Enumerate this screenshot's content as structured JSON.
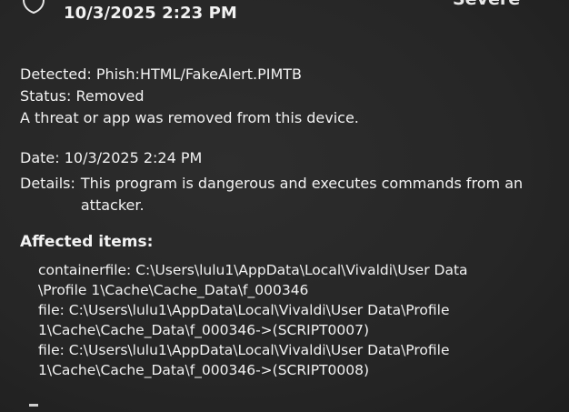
{
  "header": {
    "date_time": "10/3/2025 2:23 PM",
    "severity": "Severe"
  },
  "summary": {
    "detected_label": "Detected:",
    "detected_value": "Phish:HTML/FakeAlert.PIMTB",
    "status_label": "Status:",
    "status_value": "Removed",
    "message": "A threat or app was removed from this device."
  },
  "details": {
    "date_label": "Date:",
    "date_value": "10/3/2025 2:24 PM",
    "details_label": "Details:",
    "details_line1": "This program is dangerous and executes commands from an",
    "details_line2": "attacker."
  },
  "affected": {
    "title": "Affected items:",
    "items": [
      {
        "line1": "containerfile: C:\\Users\\lulu1\\AppData\\Local\\Vivaldi\\User Data",
        "line2": "\\Profile 1\\Cache\\Cache_Data\\f_000346"
      },
      {
        "line1": "file: C:\\Users\\lulu1\\AppData\\Local\\Vivaldi\\User Data\\Profile",
        "line2": "1\\Cache\\Cache_Data\\f_000346->(SCRIPT0007)"
      },
      {
        "line1": "file: C:\\Users\\lulu1\\AppData\\Local\\Vivaldi\\User Data\\Profile",
        "line2": "1\\Cache\\Cache_Data\\f_000346->(SCRIPT0008)"
      }
    ]
  },
  "icons": {
    "shield": "shield-icon"
  }
}
